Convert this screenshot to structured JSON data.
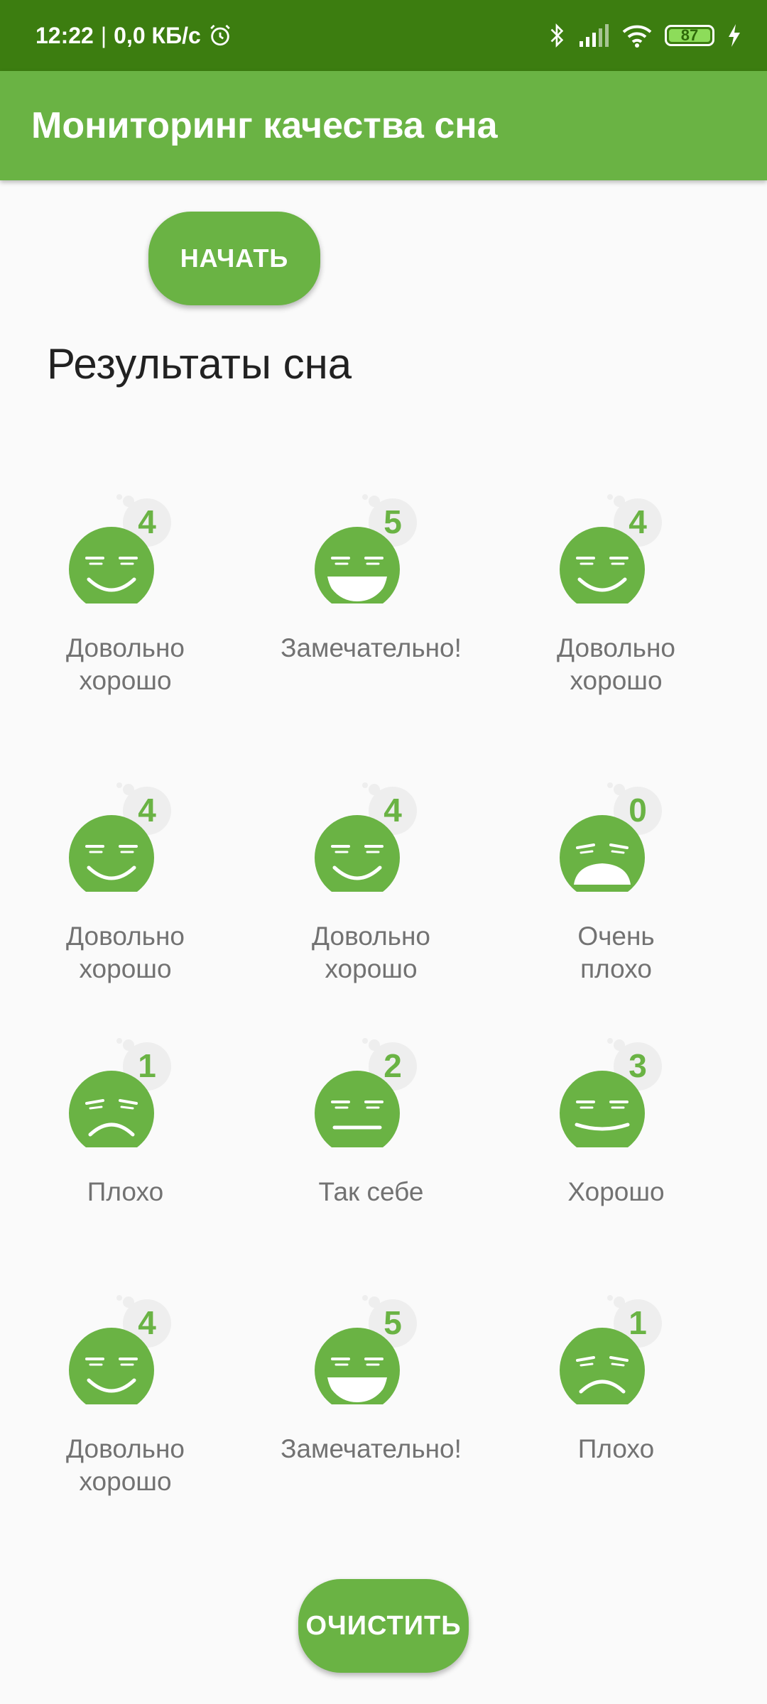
{
  "status_bar": {
    "time": "12:22",
    "network_speed": "0,0 КБ/с",
    "battery_level": "87",
    "icons": [
      "alarm-icon",
      "bluetooth-icon",
      "signal-icon",
      "wifi-icon",
      "battery-icon",
      "charging-icon"
    ]
  },
  "app_bar": {
    "title": "Мониторинг качества сна"
  },
  "start_button": {
    "label": "НАЧАТЬ"
  },
  "section_title": "Результаты сна",
  "nights": [
    {
      "score": "4",
      "face": "pretty-good",
      "label_line1": "Довольно",
      "label_line2": "хорошо"
    },
    {
      "score": "5",
      "face": "excellent",
      "label_line1": "Замечательно!",
      "label_line2": ""
    },
    {
      "score": "4",
      "face": "pretty-good",
      "label_line1": "Довольно",
      "label_line2": "хорошо"
    },
    {
      "score": "4",
      "face": "pretty-good",
      "label_line1": "Довольно",
      "label_line2": "хорошо"
    },
    {
      "score": "4",
      "face": "pretty-good",
      "label_line1": "Довольно",
      "label_line2": "хорошо"
    },
    {
      "score": "0",
      "face": "very-bad",
      "label_line1": "Очень",
      "label_line2": "плохо"
    },
    {
      "score": "1",
      "face": "bad",
      "label_line1": "Плохо",
      "label_line2": ""
    },
    {
      "score": "2",
      "face": "so-so",
      "label_line1": "Так себе",
      "label_line2": ""
    },
    {
      "score": "3",
      "face": "good",
      "label_line1": "Хорошо",
      "label_line2": ""
    },
    {
      "score": "4",
      "face": "pretty-good",
      "label_line1": "Довольно",
      "label_line2": "хорошо"
    },
    {
      "score": "5",
      "face": "excellent",
      "label_line1": "Замечательно!",
      "label_line2": ""
    },
    {
      "score": "1",
      "face": "bad",
      "label_line1": "Плохо",
      "label_line2": ""
    }
  ],
  "clear_button": {
    "label": "ОЧИСТИТЬ"
  },
  "colors": {
    "primary": "#6ab344",
    "primary_dark": "#3c7d10",
    "background": "#fafafa",
    "label_text": "#727272",
    "badge_bg": "#eeeeee"
  }
}
